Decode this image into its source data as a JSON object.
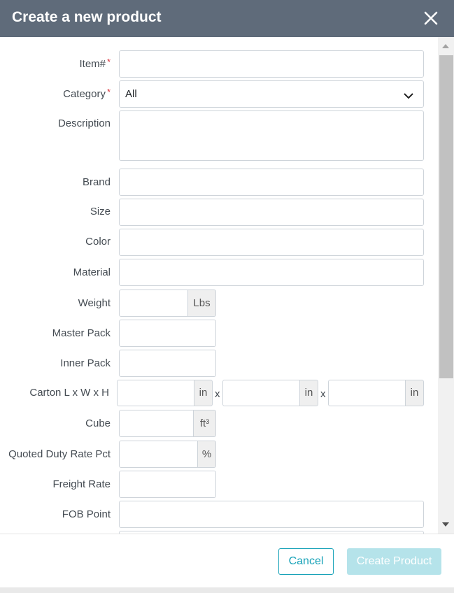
{
  "modal": {
    "title": "Create a new product",
    "close_icon": "close-icon"
  },
  "form": {
    "item_number": {
      "label": "Item#",
      "required_mark": "*",
      "value": ""
    },
    "category": {
      "label": "Category",
      "required_mark": "*",
      "selected": "All"
    },
    "description": {
      "label": "Description",
      "value": ""
    },
    "brand": {
      "label": "Brand",
      "value": ""
    },
    "size": {
      "label": "Size",
      "value": ""
    },
    "color": {
      "label": "Color",
      "value": ""
    },
    "material": {
      "label": "Material",
      "value": ""
    },
    "weight": {
      "label": "Weight",
      "unit": "Lbs",
      "value": ""
    },
    "master_pack": {
      "label": "Master Pack",
      "value": ""
    },
    "inner_pack": {
      "label": "Inner Pack",
      "value": ""
    },
    "carton": {
      "label": "Carton L x W x H",
      "unit": "in",
      "separator": "x",
      "length": "",
      "width": "",
      "height": ""
    },
    "cube": {
      "label": "Cube",
      "unit": "ft³",
      "value": ""
    },
    "quoted_duty_rate": {
      "label": "Quoted Duty Rate Pct",
      "unit": "%",
      "value": ""
    },
    "freight_rate": {
      "label": "Freight Rate",
      "value": ""
    },
    "fob_point": {
      "label": "FOB Point",
      "value": ""
    }
  },
  "footer": {
    "cancel_label": "Cancel",
    "create_label": "Create Product"
  },
  "colors": {
    "header_bg": "#5f6b7a",
    "accent": "#17a2b8",
    "disabled_primary": "#b5e3ea",
    "required": "#d9363e"
  }
}
